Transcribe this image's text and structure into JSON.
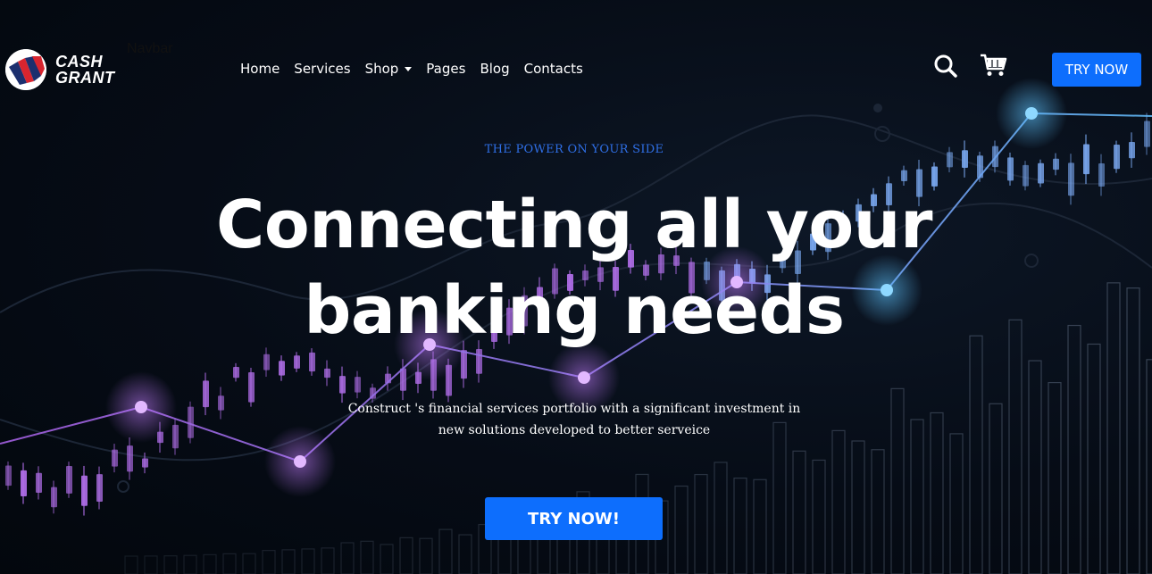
{
  "brand": {
    "name_line1": "CASH",
    "name_line2": "GRANT",
    "navbar_tag": "Navbar"
  },
  "nav": {
    "items": [
      {
        "label": "Home"
      },
      {
        "label": "Services"
      },
      {
        "label": "Shop",
        "has_dropdown": true
      },
      {
        "label": "Pages"
      },
      {
        "label": "Blog"
      },
      {
        "label": "Contacts"
      }
    ],
    "cta_label": "TRY NOW",
    "icons": [
      "search-icon",
      "cart-icon"
    ]
  },
  "hero": {
    "eyebrow": "THE POWER ON YOUR SIDE",
    "title_line1": "Connecting all your",
    "title_line2": "banking needs",
    "subtitle_line1": "Construct 's financial services portfolio with a significant investment in",
    "subtitle_line2": "new solutions developed to better serveice",
    "cta_label": "TRY NOW!"
  },
  "colors": {
    "accent": "#0d6efd",
    "eyebrow": "#2f6fe6",
    "background": "#050b14",
    "candle_purple": "#b06ee8",
    "candle_blue": "#7aa8f0",
    "glow_cyan": "#5fc4ff"
  }
}
